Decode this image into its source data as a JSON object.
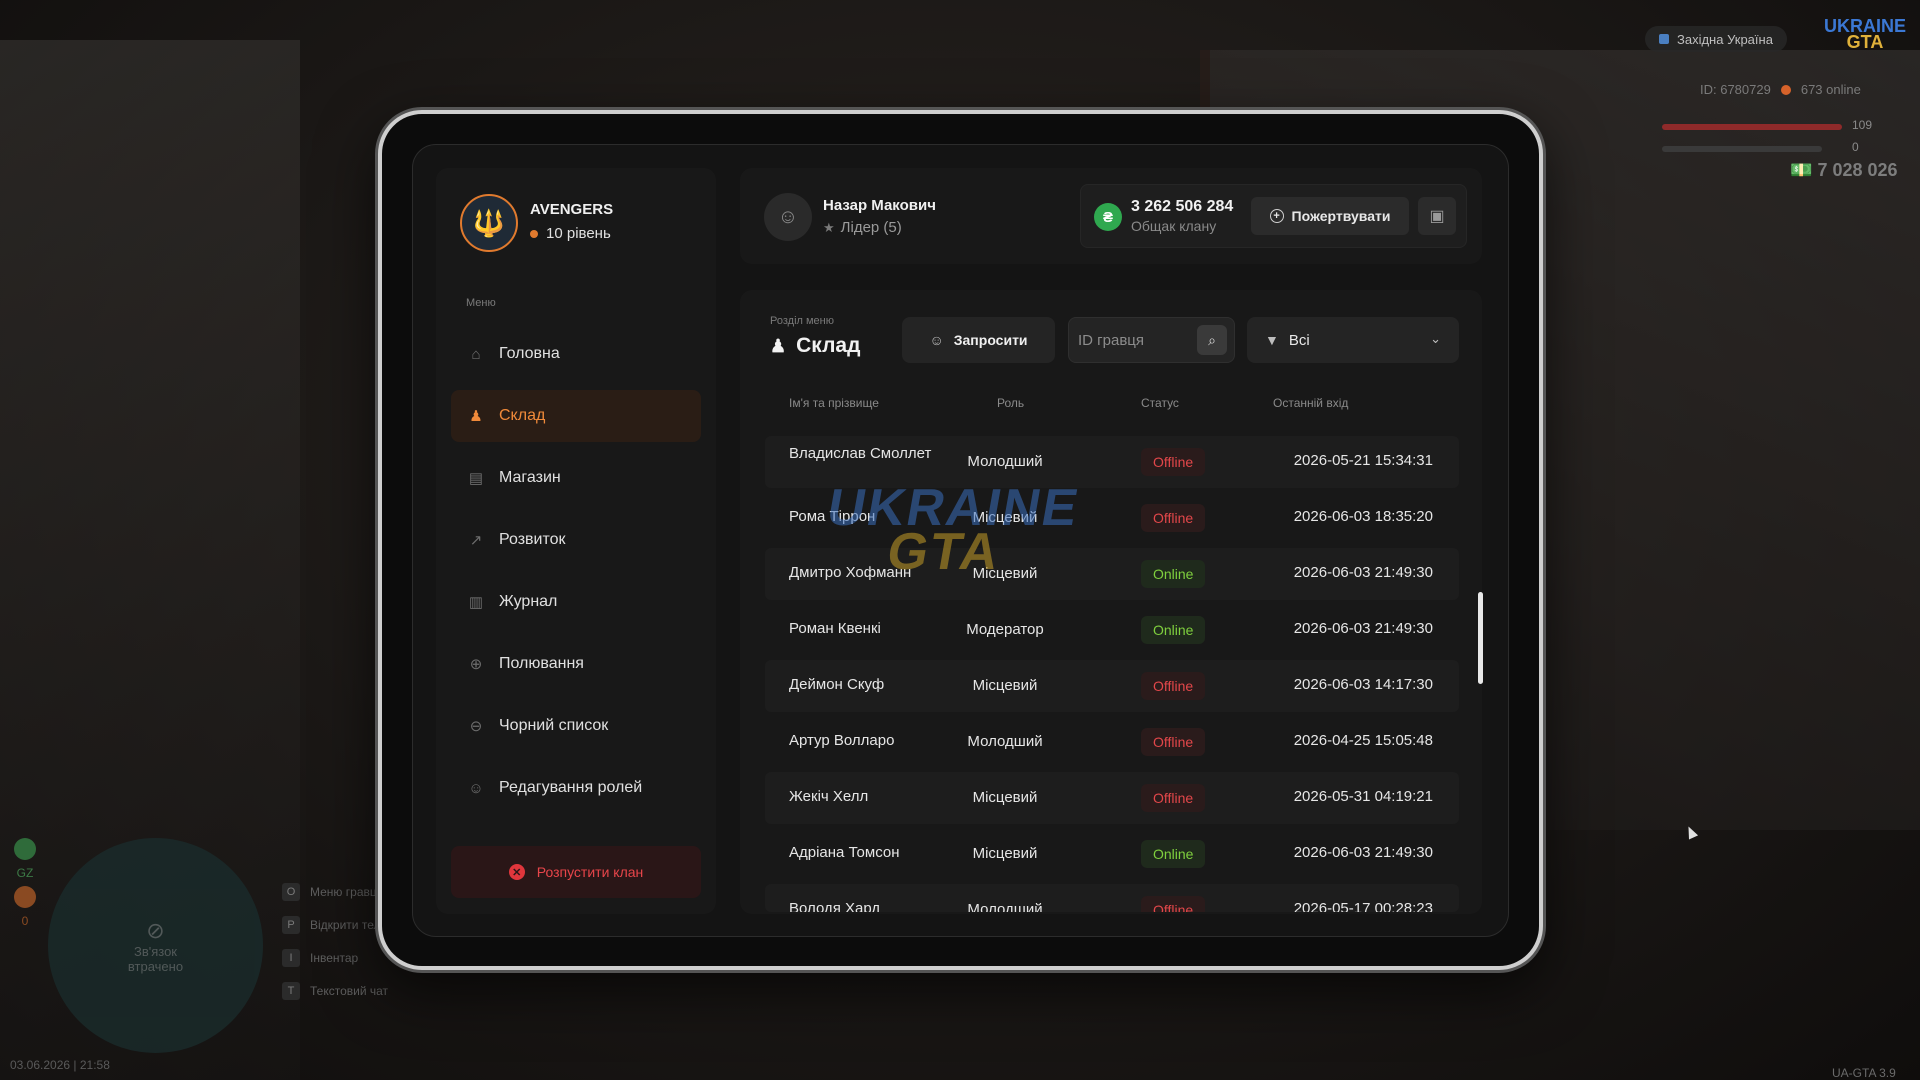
{
  "hud": {
    "server": "Західна Україна",
    "logo_line1": "UKRAINE",
    "logo_line2": "GTA",
    "player_id": "ID: 6780729",
    "online": "673 online",
    "health": "109",
    "armor": "0",
    "money": "7 028 026",
    "minimap_text": "Зв'язок втрачено",
    "gz_label": "GZ",
    "left_counter": "0",
    "hotkeys": [
      {
        "key": "O",
        "label": "Меню гравця"
      },
      {
        "key": "P",
        "label": "Відкрити телефон"
      },
      {
        "key": "I",
        "label": "Інвентар"
      },
      {
        "key": "T",
        "label": "Текстовий чат"
      }
    ],
    "datetime": "03.06.2026 | 21:58",
    "version": "UA-GTA 3.9"
  },
  "clan": {
    "name": "AVENGERS",
    "level": "10 рівень"
  },
  "menu": {
    "caption": "Меню",
    "items": [
      {
        "label": "Головна",
        "icon": "home-icon"
      },
      {
        "label": "Склад",
        "icon": "people-icon"
      },
      {
        "label": "Магазин",
        "icon": "shop-icon"
      },
      {
        "label": "Розвиток",
        "icon": "chart-icon"
      },
      {
        "label": "Журнал",
        "icon": "book-icon"
      },
      {
        "label": "Полювання",
        "icon": "target-icon"
      },
      {
        "label": "Чорний список",
        "icon": "block-icon"
      },
      {
        "label": "Редагування ролей",
        "icon": "user-edit-icon"
      }
    ],
    "active_index": 1,
    "disband_label": "Розпустити клан"
  },
  "user": {
    "name": "Назар Макович",
    "role": "Лідер (5)",
    "balance": "3 262 506 284",
    "balance_label": "Общак клану",
    "donate_label": "Пожертвувати"
  },
  "section": {
    "caption": "Розділ меню",
    "title": "Склад",
    "invite_label": "Запросити",
    "search_placeholder": "ID гравця",
    "filter_value": "Всі"
  },
  "table": {
    "headers": [
      "Ім'я та прізвище",
      "Роль",
      "Статус",
      "Останній вхід"
    ],
    "rows": [
      {
        "name": "Владислав Смоллет",
        "role": "Молодший",
        "status": "Offline",
        "last": "2026-05-21 15:34:31"
      },
      {
        "name": "Рома Тіррон",
        "role": "Місцевий",
        "status": "Offline",
        "last": "2026-06-03 18:35:20"
      },
      {
        "name": "Дмитро Хофманн",
        "role": "Місцевий",
        "status": "Online",
        "last": "2026-06-03 21:49:30"
      },
      {
        "name": "Роман Квенкі",
        "role": "Модератор",
        "status": "Online",
        "last": "2026-06-03 21:49:30"
      },
      {
        "name": "Деймон Скуф",
        "role": "Місцевий",
        "status": "Offline",
        "last": "2026-06-03 14:17:30"
      },
      {
        "name": "Артур Волларо",
        "role": "Молодший",
        "status": "Offline",
        "last": "2026-04-25 15:05:48"
      },
      {
        "name": "Жекіч Хелл",
        "role": "Місцевий",
        "status": "Offline",
        "last": "2026-05-31 04:19:21"
      },
      {
        "name": "Адріана Томсон",
        "role": "Місцевий",
        "status": "Online",
        "last": "2026-06-03 21:49:30"
      },
      {
        "name": "Володя Хард",
        "role": "Молодший",
        "status": "Offline",
        "last": "2026-05-17 00:28:23"
      }
    ]
  },
  "watermark": {
    "line1": "UKRAINE",
    "line2": "GTA"
  },
  "colors": {
    "accent": "#f08a3a",
    "online": "#7fcf3e",
    "offline": "#e2474a",
    "coin": "#2fa84f"
  }
}
